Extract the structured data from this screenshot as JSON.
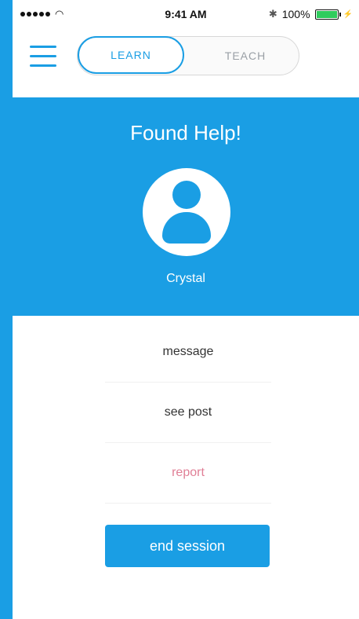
{
  "status_bar": {
    "time": "9:41 AM",
    "battery_text": "100%",
    "battery_level": 1.0
  },
  "nav": {
    "menu_icon": "hamburger-menu-icon",
    "segments": [
      {
        "label": "LEARN",
        "active": true
      },
      {
        "label": "TEACH",
        "active": false
      }
    ]
  },
  "hero": {
    "title": "Found Help!",
    "name": "Crystal",
    "avatar_icon": "user-icon"
  },
  "options": [
    {
      "label": "message"
    },
    {
      "label": "see post"
    },
    {
      "label": "report"
    }
  ],
  "end_button": {
    "label": "end session"
  },
  "colors": {
    "primary": "#1a9ee4",
    "report": "#e07f96",
    "battery_fill": "#2fcc5d"
  }
}
